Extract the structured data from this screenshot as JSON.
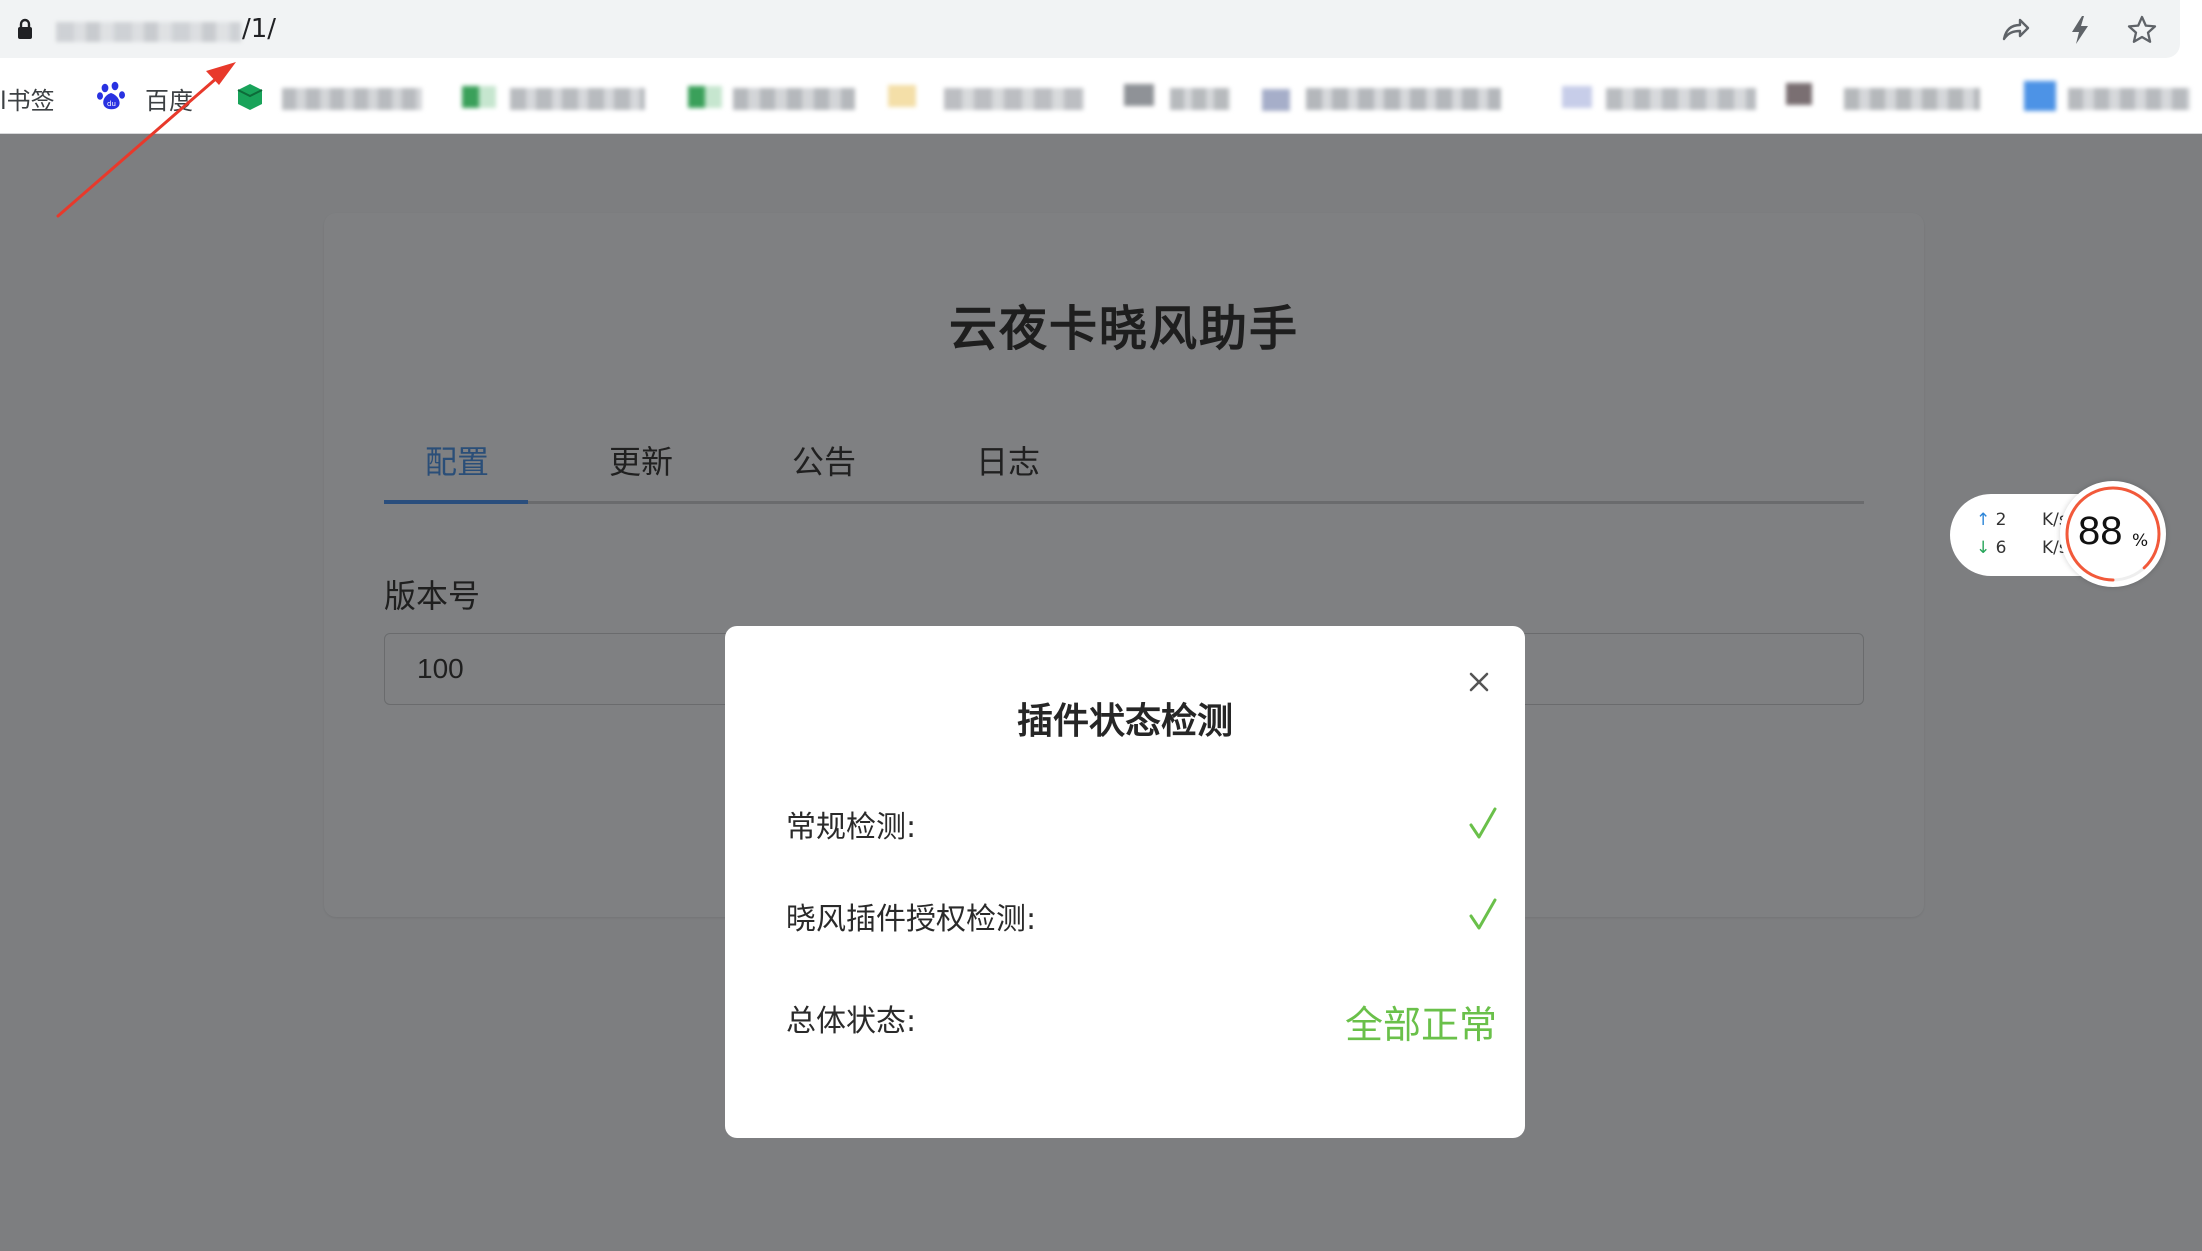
{
  "browser": {
    "url_suffix": "/1/",
    "bookmarks": {
      "first_label": "l书签",
      "baidu_label": "百度"
    }
  },
  "page": {
    "title": "云夜卡晓风助手",
    "tabs": [
      {
        "label": "配置",
        "active": true
      },
      {
        "label": "更新",
        "active": false
      },
      {
        "label": "公告",
        "active": false
      },
      {
        "label": "日志",
        "active": false
      }
    ],
    "version_label": "版本号",
    "version_value": "100"
  },
  "net_widget": {
    "upload_value": "2",
    "download_value": "6",
    "unit": "K/s",
    "gauge_value": "88",
    "gauge_unit": "%",
    "gauge_fraction": 0.88,
    "gauge_color": "#f2593a"
  },
  "modal": {
    "title": "插件状态检测",
    "rows": [
      {
        "label": "常规检测:",
        "status_icon": "check-icon"
      },
      {
        "label": "晓风插件授权检测:",
        "status_icon": "check-icon"
      }
    ],
    "overall_label": "总体状态:",
    "overall_status": "全部正常",
    "ok_color": "#6ac04a"
  },
  "annotation": {
    "arrow_color": "#e8392b"
  }
}
